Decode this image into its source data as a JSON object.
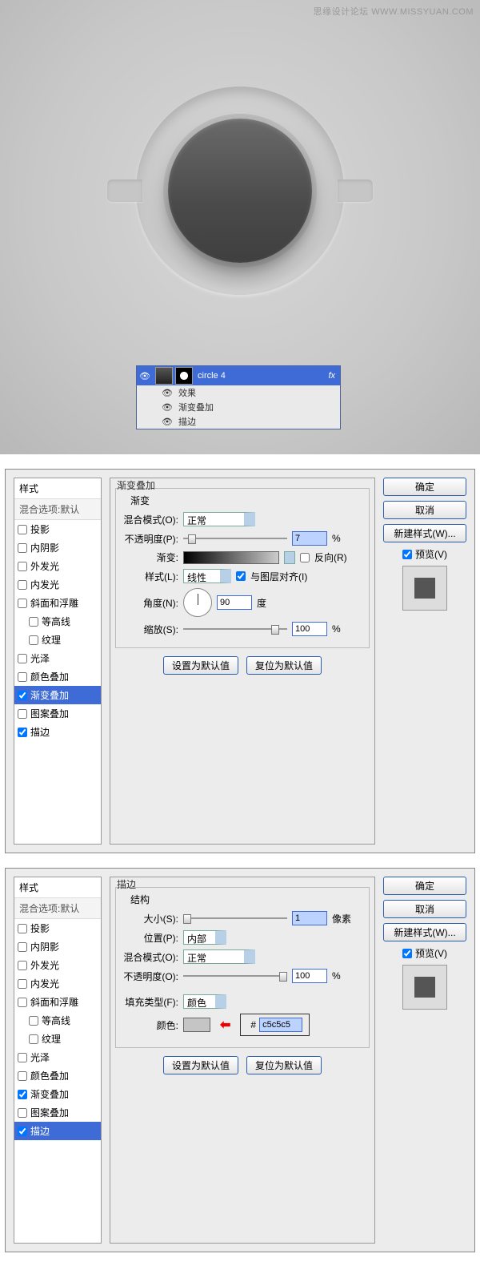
{
  "watermark": "思缘设计论坛  WWW.MISSYUAN.COM",
  "layers": {
    "name": "circle 4",
    "fx_label": "fx",
    "effects": "效果",
    "sub1": "渐变叠加",
    "sub2": "描边"
  },
  "styles_list": {
    "header": "样式",
    "blend_header": "混合选项:默认",
    "items": [
      "投影",
      "内阴影",
      "外发光",
      "内发光",
      "斜面和浮雕",
      "等高线",
      "纹理",
      "光泽",
      "颜色叠加",
      "渐变叠加",
      "图案叠加",
      "描边"
    ]
  },
  "panel1": {
    "title": "渐变叠加",
    "group": "渐变",
    "blend_mode_label": "混合模式(O):",
    "blend_mode_value": "正常",
    "opacity_label": "不透明度(P):",
    "opacity_value": "7",
    "opacity_unit": "%",
    "gradient_label": "渐变:",
    "reverse_label": "反向(R)",
    "style_label": "样式(L):",
    "style_value": "线性",
    "align_label": "与图层对齐(I)",
    "angle_label": "角度(N):",
    "angle_value": "90",
    "angle_unit": "度",
    "scale_label": "缩放(S):",
    "scale_value": "100",
    "scale_unit": "%",
    "set_default": "设置为默认值",
    "reset_default": "复位为默认值"
  },
  "panel2": {
    "title": "描边",
    "group1": "结构",
    "size_label": "大小(S):",
    "size_value": "1",
    "size_unit": "像素",
    "position_label": "位置(P):",
    "position_value": "内部",
    "blend_mode_label": "混合模式(O):",
    "blend_mode_value": "正常",
    "opacity_label": "不透明度(O):",
    "opacity_value": "100",
    "opacity_unit": "%",
    "fill_type_label": "填充类型(F):",
    "fill_type_value": "颜色",
    "color_label": "颜色:",
    "hex_value": "c5c5c5",
    "set_default": "设置为默认值",
    "reset_default": "复位为默认值"
  },
  "side": {
    "ok": "确定",
    "cancel": "取消",
    "new_style": "新建样式(W)...",
    "preview": "预览(V)"
  }
}
